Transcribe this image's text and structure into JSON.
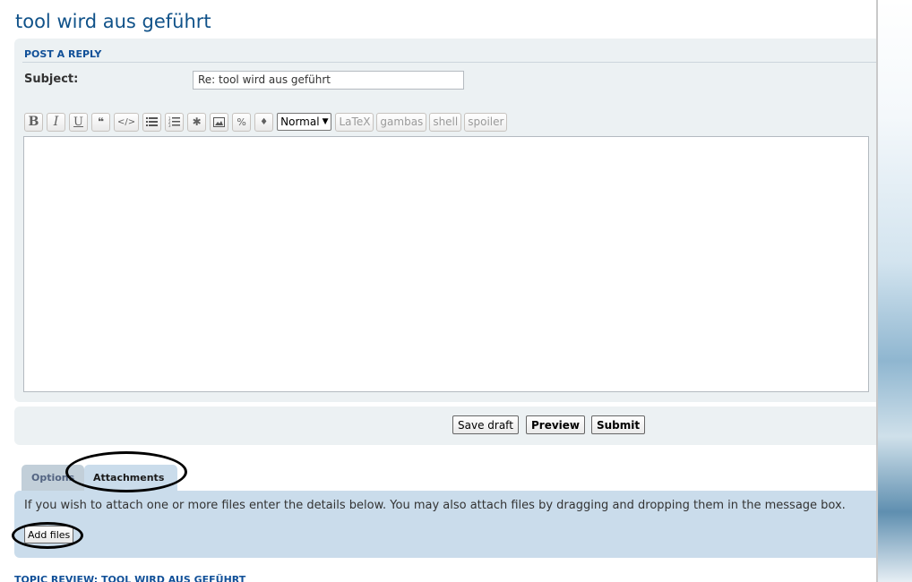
{
  "page": {
    "title": "tool wird aus geführt"
  },
  "reply_form": {
    "heading": "POST A REPLY",
    "subject_label": "Subject:",
    "subject_value": "Re: tool wird aus geführt"
  },
  "toolbar": {
    "bold": "B",
    "italic": "I",
    "underline": "U",
    "quote": "❝",
    "code": "</>",
    "list": "☰",
    "list_numbered": "⅓",
    "list_item": "✱",
    "image": "▣",
    "url": "%",
    "color": "♦",
    "font_size": "Normal",
    "custom_tags": [
      "LaTeX",
      "gambas",
      "shell",
      "spoiler"
    ]
  },
  "message": {
    "value": ""
  },
  "actions": {
    "save_draft": "Save draft",
    "preview": "Preview",
    "submit": "Submit"
  },
  "tabs": {
    "options": "Options",
    "attachments": "Attachments"
  },
  "attachments": {
    "help_text": "If you wish to attach one or more files enter the details below. You may also attach files by dragging and dropping them in the message box.",
    "add_files": "Add files"
  },
  "topic_review": "TOPIC REVIEW: TOOL WIRD AUS GEFÜHRT",
  "colors": {
    "heading_blue": "#105289",
    "panel_bg": "#ecf1f3",
    "active_tab_bg": "#cadceb",
    "inactive_tab_bg": "#c2cfd9"
  }
}
